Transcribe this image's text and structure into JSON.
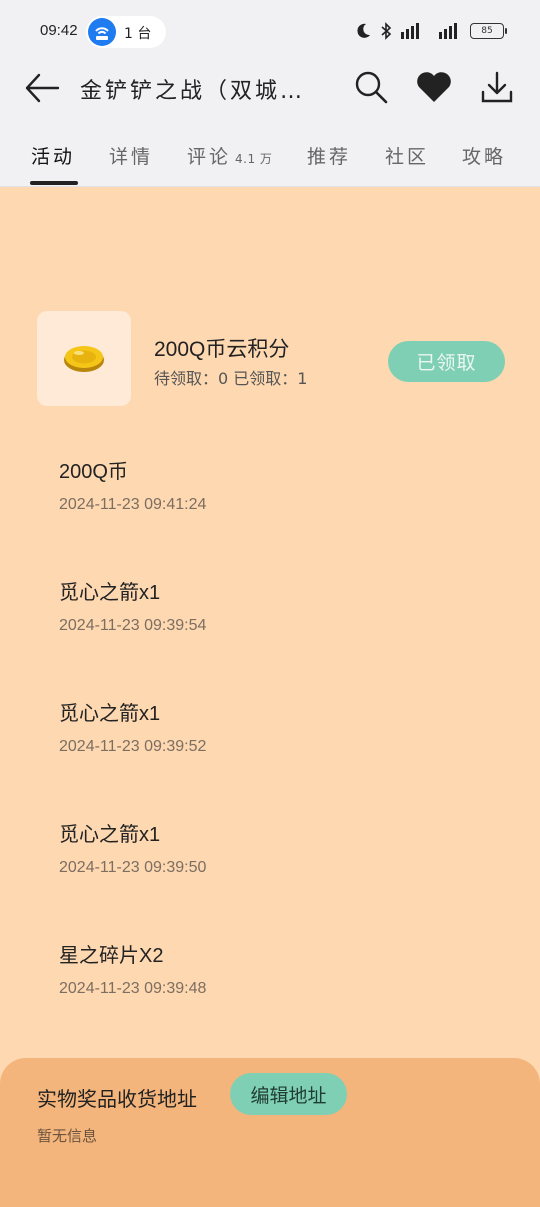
{
  "status_bar": {
    "time": "09:42",
    "hotspot_count": "1 台",
    "battery": "85"
  },
  "header": {
    "title": "金铲铲之战（双城…"
  },
  "tabs": [
    {
      "label": "活动",
      "sub": "",
      "active": true
    },
    {
      "label": "详情",
      "sub": ""
    },
    {
      "label": "评论",
      "sub": "4.1 万"
    },
    {
      "label": "推荐",
      "sub": ""
    },
    {
      "label": "社区",
      "sub": ""
    },
    {
      "label": "攻略",
      "sub": ""
    }
  ],
  "reward": {
    "title": "200Q币云积分",
    "stats": "待领取：0 已领取：1",
    "button": "已领取"
  },
  "records": [
    {
      "name": "200Q币",
      "time": "2024-11-23 09:41:24"
    },
    {
      "name": "觅心之箭x1",
      "time": "2024-11-23 09:39:54"
    },
    {
      "name": "觅心之箭x1",
      "time": "2024-11-23 09:39:52"
    },
    {
      "name": "觅心之箭x1",
      "time": "2024-11-23 09:39:50"
    },
    {
      "name": "星之碎片X2",
      "time": "2024-11-23 09:39:48"
    }
  ],
  "address": {
    "label": "实物奖品收货地址",
    "edit_button": "编辑地址",
    "empty_text": "暂无信息"
  },
  "colors": {
    "page_bg": "#fed8b1",
    "accent_green": "#7fcfb5",
    "sheet_bg": "#f3b57b"
  }
}
